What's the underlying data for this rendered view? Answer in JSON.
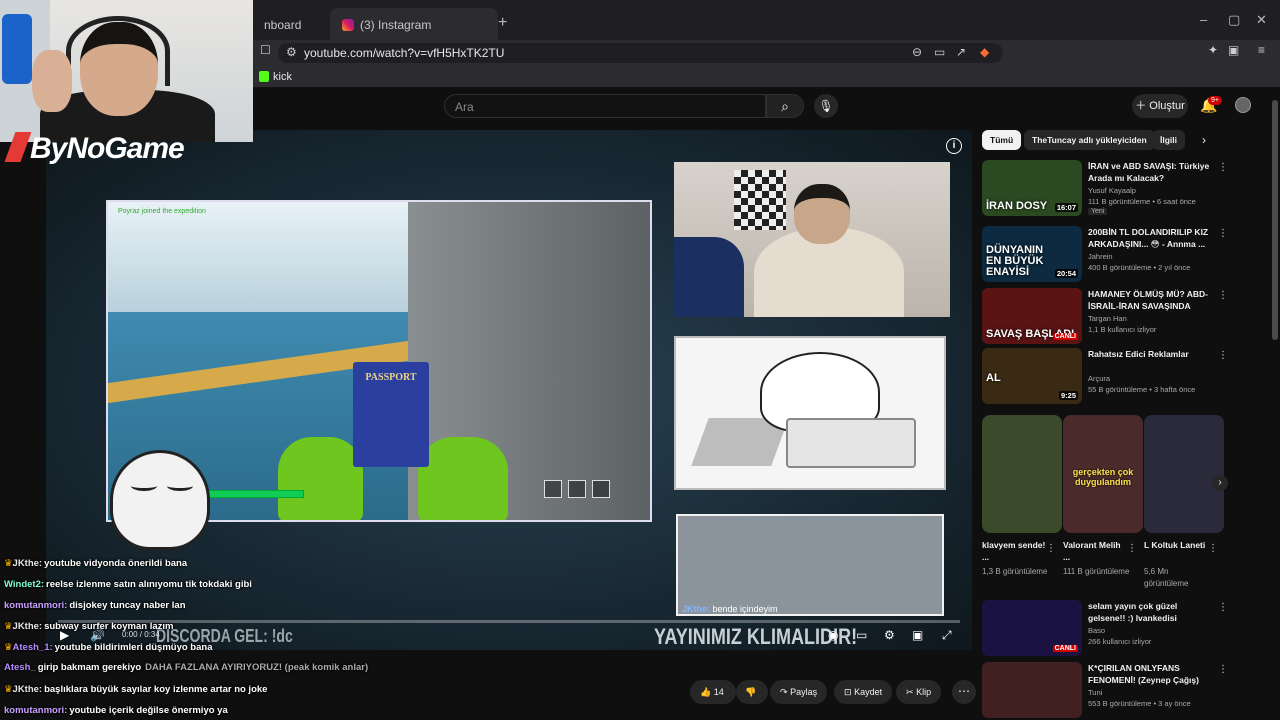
{
  "browser": {
    "tabs": [
      {
        "label": "nboard"
      },
      {
        "label": "(3) Instagram"
      }
    ],
    "new_tab": "+",
    "url": "youtube.com/watch?v=vfH5HxTK2TU",
    "bookmarks": [
      {
        "label": "kick"
      }
    ],
    "window_controls": {
      "minimize": "–",
      "maximize": "▢",
      "close": "✕"
    }
  },
  "youtube": {
    "search_placeholder": "Ara",
    "create_label": "Oluştur",
    "notification_count": "9+"
  },
  "stream": {
    "logo_text": "ByNoGame",
    "overlay_text": "YAYINIMIZ KLIMALIDIR!",
    "discord_text": "DISCORDA GEL: !dc",
    "overlay_chat": {
      "user": "JKthe:",
      "message": "bende içindeyim"
    },
    "game_passport": "PASSPORT",
    "game_notice": "Poyraz joined the expedition",
    "timecode": "0:00 / 0:34"
  },
  "chat": [
    {
      "user": "JKthe:",
      "message": "youtube vidyonda önerildi bana",
      "color": "#e8e8e8"
    },
    {
      "user": "Windet2:",
      "message": "reelse izlenme satın alınıyomu tik tokdaki gibi",
      "color": "#7fffd4"
    },
    {
      "user": "komutanmori:",
      "message": "disjokey tuncay naber lan",
      "color": "#c9a0ff"
    },
    {
      "user": "JKthe:",
      "message": "subway surfer koyman lazım",
      "color": "#e8e8e8"
    },
    {
      "user": "Atesh_1:",
      "message": "youtube bildirimleri düşmüyo bana",
      "color": "#b58cff"
    },
    {
      "user": "Atesh_",
      "message": "girip bakmam gerekiyo",
      "color": "#b58cff"
    },
    {
      "user": "JKthe:",
      "message": "başlıklara büyük sayılar koy izlenme artar no joke",
      "color": "#e8e8e8"
    },
    {
      "user": "komutanmori:",
      "message": "youtube içerik değilse önermiyo ya",
      "color": "#c9a0ff"
    }
  ],
  "chat_faded": {
    "line1": "DAHA FAZLANA AYIRIYORUZ! (peak komik anlar)"
  },
  "actions": {
    "like_count": "14",
    "share": "Paylaş",
    "save": "Kaydet",
    "clip": "Klip"
  },
  "sidebar": {
    "chips": [
      "Tümü",
      "TheTuncay adlı yükleyiciden",
      "İlgili"
    ],
    "recommendations": [
      {
        "title": "İRAN ve ABD SAVAŞI: Türkiye Arada mı Kalacak?",
        "channel": "Yusuf Kayaalp",
        "meta": "111 B görüntüleme • 6 saat önce",
        "badge": "Yeni",
        "duration": "16:07",
        "thumb_text": "İRAN DOSY",
        "thumb_color": "#2b4a22"
      },
      {
        "title": "200BİN TL DOLANDIRILIP KIZ ARKADAŞINI... 😳 - Annma ...",
        "channel": "Jahrein",
        "meta": "400 B görüntüleme • 2 yıl önce",
        "badge": "",
        "duration": "20:54",
        "thumb_text": "DÜNYANIN EN BÜYÜK ENAYİSİ",
        "thumb_color": "#0d2a40"
      },
      {
        "title": "HAMANEY ÖLMÜŞ MÜ? ABD-İSRAİL-İRAN SAVAŞINDA SON...",
        "channel": "Targan Han",
        "meta": "1,1 B kullanıcı izliyor",
        "badge": "",
        "duration": "",
        "live": "CANLI",
        "thumb_text": "SAVAŞ BAŞLADI",
        "thumb_color": "#5a1414"
      },
      {
        "title": "Rahatsız Edici Reklamlar",
        "channel": "Arçura",
        "meta": "55 B görüntüleme • 3 hafta önce",
        "badge": "",
        "duration": "9:25",
        "thumb_text": "AL",
        "thumb_color": "#3a2a14"
      }
    ],
    "shorts": [
      {
        "title": "klavyem sende! ...",
        "views": "1,3 B görüntüleme",
        "caption": "",
        "color": "#3a4a2a"
      },
      {
        "title": "Valorant Melih ...",
        "views": "111 B görüntüleme",
        "caption": "gerçekten çok duygulandım",
        "color": "#4a2a2a"
      },
      {
        "title": "L Koltuk Laneti",
        "views": "5,6 Mn görüntüleme",
        "caption": "",
        "color": "#2a2a3a"
      }
    ],
    "recommendations2": [
      {
        "title": "selam yayın çok güzel gelsene!! :) lvankedisi",
        "channel": "Baso",
        "meta": "266 kullanıcı izliyor",
        "live": "CANLI",
        "thumb_color": "#1a1240"
      },
      {
        "title": "K*ÇIRILAN ONLYFANS FENOMENİ! (Zeynep Çağış)",
        "channel": "Tuni",
        "meta": "553 B görüntüleme • 3 ay önce",
        "thumb_color": "#402020"
      }
    ]
  },
  "colors": {
    "accent": "#cc0000",
    "kick": "#53fc18",
    "bg": "#0f0f0f"
  },
  "icons": [
    "search-icon",
    "mic-icon",
    "bell-icon",
    "like-icon",
    "dislike-icon",
    "share-icon",
    "save-icon",
    "clip-icon",
    "more-icon",
    "info-icon",
    "settings-icon",
    "fullscreen-icon"
  ]
}
